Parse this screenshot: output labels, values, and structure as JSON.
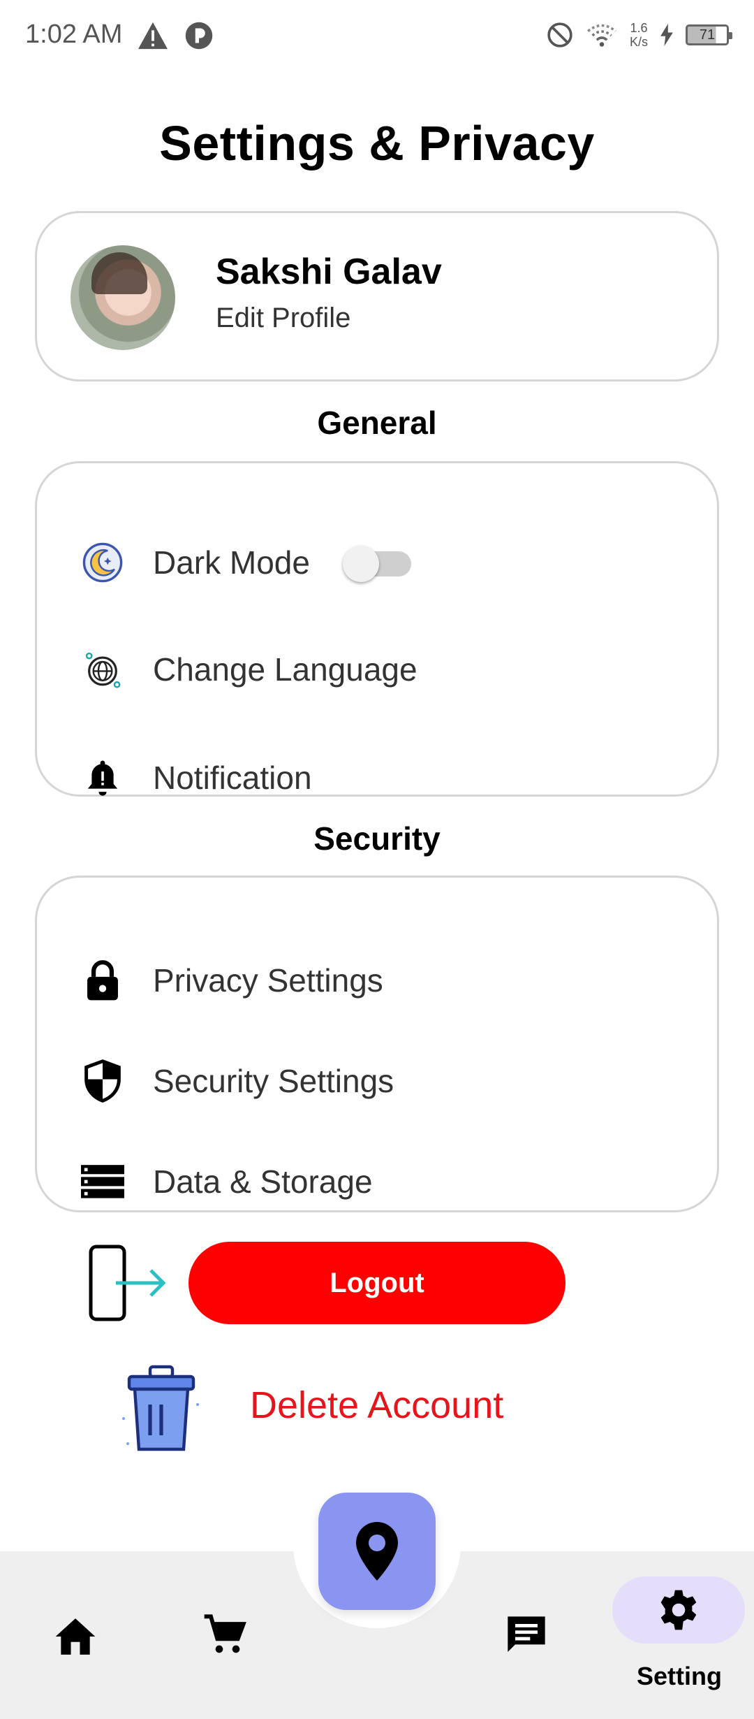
{
  "status_bar": {
    "time": "1:02 AM",
    "speed_value": "1.6",
    "speed_unit": "K/s",
    "battery": "71"
  },
  "page": {
    "title": "Settings & Privacy"
  },
  "profile": {
    "name": "Sakshi Galav",
    "edit_label": "Edit Profile"
  },
  "general": {
    "heading": "General",
    "items": [
      {
        "label": "Dark Mode",
        "icon": "moon-icon",
        "toggle_on": false
      },
      {
        "label": "Change Language",
        "icon": "globe-icon"
      },
      {
        "label": "Notification",
        "icon": "bell-icon"
      }
    ]
  },
  "security": {
    "heading": "Security",
    "items": [
      {
        "label": "Privacy Settings",
        "icon": "lock-icon"
      },
      {
        "label": "Security Settings",
        "icon": "shield-icon"
      },
      {
        "label": "Data & Storage",
        "icon": "storage-icon"
      }
    ]
  },
  "actions": {
    "logout_label": "Logout",
    "delete_label": "Delete Account"
  },
  "bottom_nav": {
    "setting_label": "Setting",
    "accent": "#8a95f2",
    "active_bg": "#e5defb"
  },
  "colors": {
    "logout": "#ff0000",
    "delete_text": "#e8141c"
  }
}
